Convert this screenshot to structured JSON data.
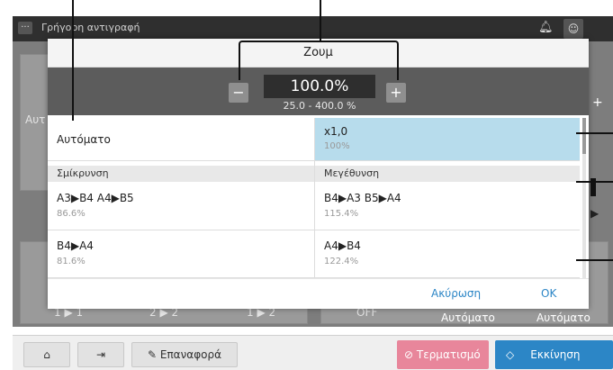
{
  "app": {
    "title": "Γρήγορη αντιγραφή",
    "background_labels": [
      "Αυτ",
      "1 ▶ 1",
      "2 ▶ 2",
      "1 ▶ 2",
      "OFF",
      "Αυτόματο",
      "Αυτόματο"
    ]
  },
  "bottom_bar": {
    "reset_label": "Επαναφορά",
    "stop_label": "Τερματισμό",
    "start_label": "Εκκίνηση"
  },
  "dialog": {
    "title": "Ζουμ",
    "zoom_value": "100.0%",
    "zoom_range": "25.0 - 400.0 %",
    "auto_label": "Αυτόματο",
    "x1_label": "x1,0",
    "x1_percent": "100%",
    "reduce_header": "Σμίκρυνση",
    "enlarge_header": "Μεγέθυνση",
    "reduce_items": [
      {
        "label": "A3▶B4 A4▶B5",
        "percent": "86.6%"
      },
      {
        "label": "B4▶A4",
        "percent": "81.6%"
      }
    ],
    "enlarge_items": [
      {
        "label": "B4▶A3 B5▶A4",
        "percent": "115.4%"
      },
      {
        "label": "A4▶B4",
        "percent": "122.4%"
      }
    ],
    "cancel_label": "Ακύρωση",
    "ok_label": "OK"
  },
  "colors": {
    "selected": "#b7dcec",
    "accent": "#2c86c6",
    "stop": "#e8869b"
  }
}
